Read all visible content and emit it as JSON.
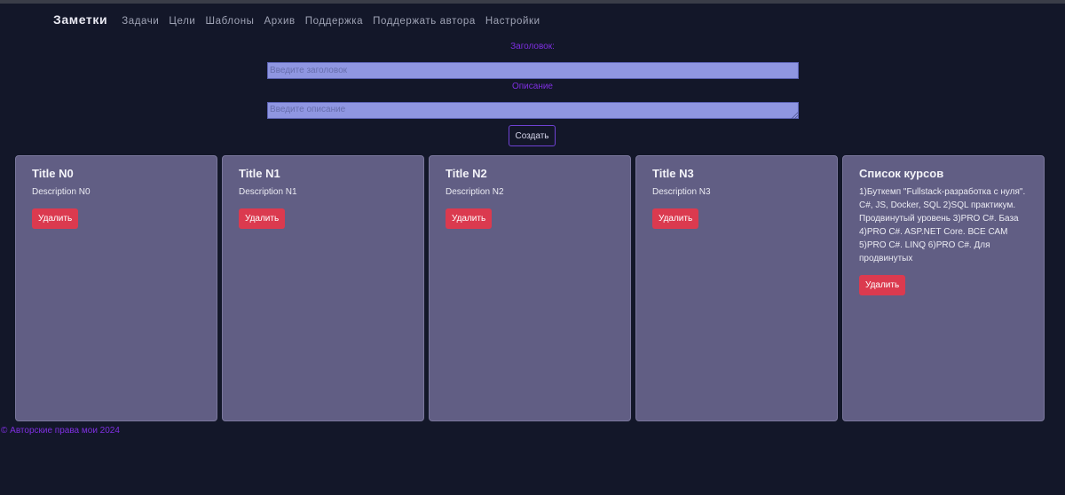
{
  "nav": {
    "brand": "Заметки",
    "links": [
      "Задачи",
      "Цели",
      "Шаблоны",
      "Архив",
      "Поддержка",
      "Поддержать автора",
      "Настройки"
    ]
  },
  "form": {
    "title_label": "Заголовок:",
    "title_placeholder": "Введите заголовок",
    "title_value": "",
    "description_label": "Описание",
    "description_placeholder": "Введите описание",
    "description_value": "",
    "create_button": "Создать"
  },
  "notes": [
    {
      "title": "Title N0",
      "description": "Description N0",
      "delete_label": "Удалить"
    },
    {
      "title": "Title N1",
      "description": "Description N1",
      "delete_label": "Удалить"
    },
    {
      "title": "Title N2",
      "description": "Description N2",
      "delete_label": "Удалить"
    },
    {
      "title": "Title N3",
      "description": "Description N3",
      "delete_label": "Удалить"
    },
    {
      "title": "Список курсов",
      "description": "1)Буткемп \"Fullstack-разработка с нуля\". C#, JS, Docker, SQL 2)SQL практикум. Продвинутый уровень 3)PRO C#. База 4)PRO C#. ASP.NET Core. ВСЕ САМ 5)PRO C#. LINQ 6)PRO C#. Для продвинутых",
      "delete_label": "Удалить"
    }
  ],
  "footer": {
    "text": "© Авторские права мои 2024"
  },
  "colors": {
    "background": "#131729",
    "card": "#615e84",
    "accent_purple": "#7e2fe0",
    "input_fill": "#8f96e1",
    "delete_red": "#db3a4f"
  }
}
